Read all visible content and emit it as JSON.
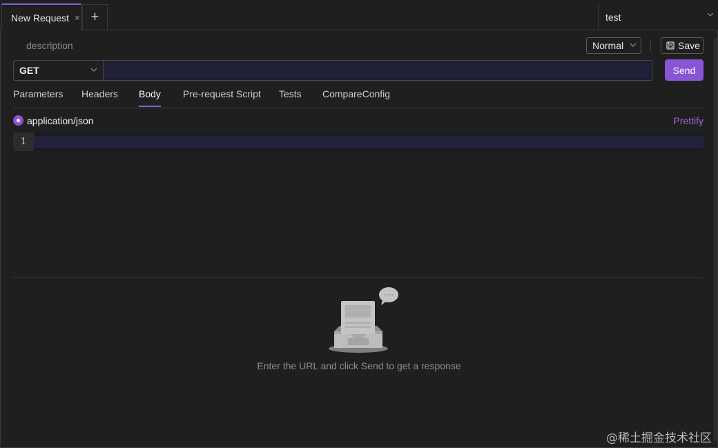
{
  "tabs": [
    {
      "label": "New Request",
      "close_icon": "×"
    }
  ],
  "new_tab_icon": "+",
  "environment": {
    "selected": "test"
  },
  "request": {
    "description_placeholder": "description",
    "mode": "Normal",
    "save_label": "Save",
    "method": "GET",
    "url": "",
    "send_label": "Send"
  },
  "request_tabs": [
    "Parameters",
    "Headers",
    "Body",
    "Pre-request Script",
    "Tests",
    "CompareConfig"
  ],
  "active_request_tab": "Body",
  "body": {
    "content_type": "application/json",
    "prettify_label": "Prettify",
    "line_numbers": [
      "1"
    ]
  },
  "response": {
    "empty_hint": "Enter the URL and click Send to get a response"
  },
  "watermark": "@稀土掘金技术社区",
  "colors": {
    "accent": "#8a55d4",
    "background": "#1f1f1f",
    "border": "#3a3a3a"
  }
}
